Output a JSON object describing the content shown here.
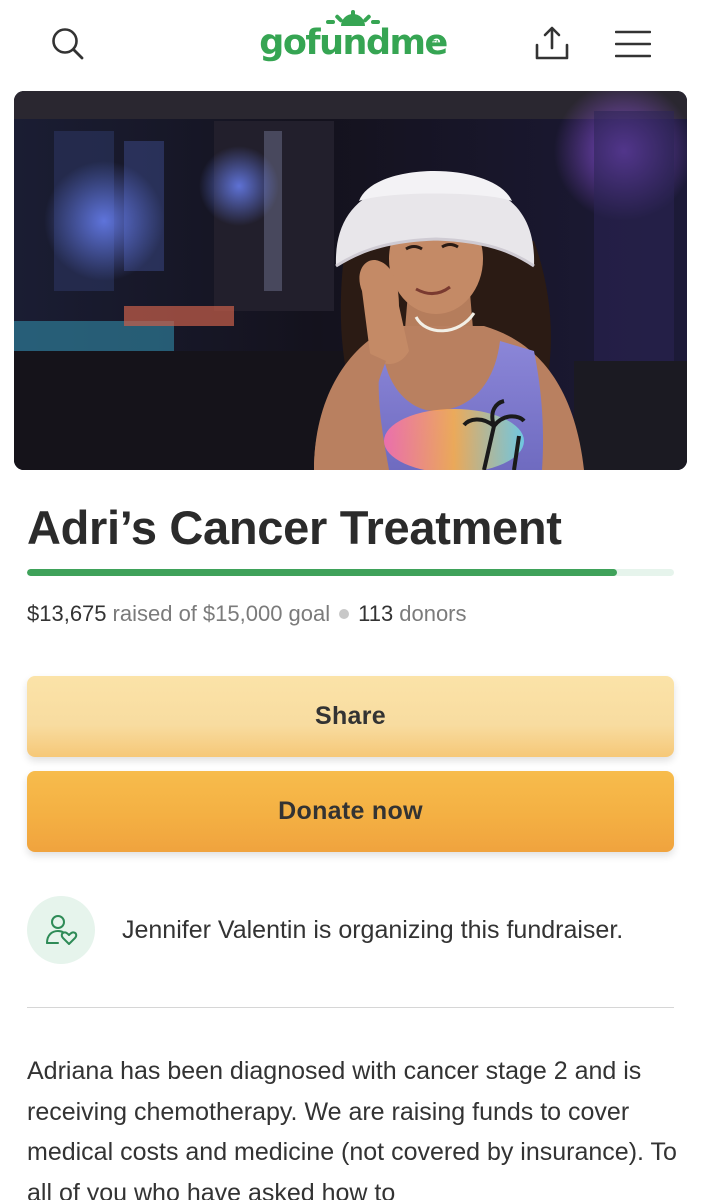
{
  "header": {
    "logo_text": "gofundme",
    "logo_tm": "TM",
    "icons": [
      "search-icon",
      "share-upload-icon",
      "hamburger-menu-icon"
    ]
  },
  "hero_image": {
    "alt": "Adri's Cancer Treatment"
  },
  "campaign": {
    "title": "Adri’s Cancer Treatment",
    "raised": "$13,675",
    "raised_text": "raised of",
    "goal": "$15,000 goal",
    "donors_count": "113",
    "donors_text": "donors",
    "progress_fraction": 0.9117
  },
  "actions": {
    "share_label": "Share",
    "donate_label": "Donate now"
  },
  "organizer": {
    "text": "Jennifer Valentin is organizing this fundraiser.",
    "icon": "user-heart-icon"
  },
  "story": {
    "text": "Adriana has been diagnosed with cancer stage 2 and is receiving chemotherapy. We are raising funds to cover medical costs and medicine (not covered by insurance). To all of you who have asked how to"
  },
  "colors": {
    "brand_green": "#36a553",
    "progress_green": "#3fa25a",
    "share_button": "#f8dca0",
    "donate_button": "#f4b043"
  }
}
